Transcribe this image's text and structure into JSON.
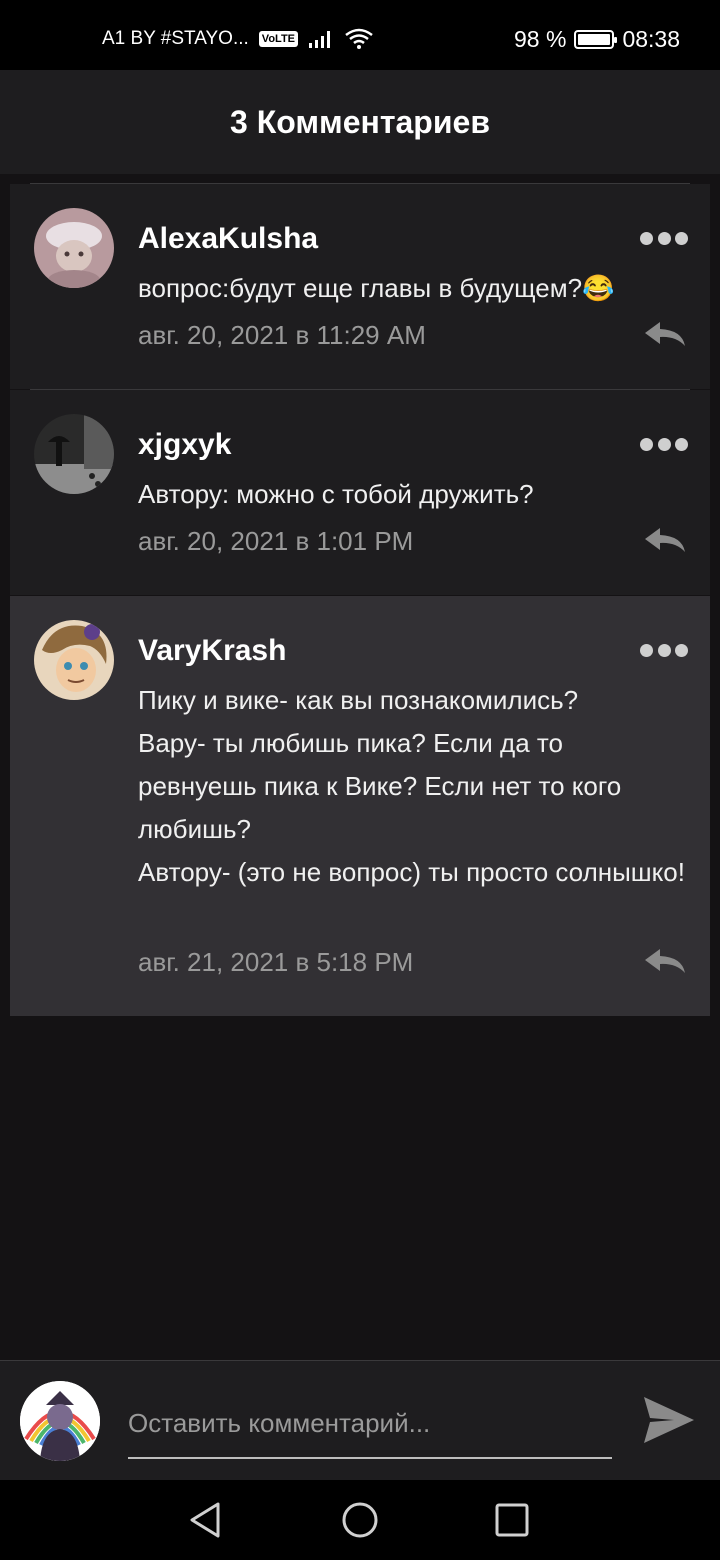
{
  "status_bar": {
    "carrier": "A1 BY #STAYO...",
    "volte": "VoLTE",
    "battery_text": "98 %",
    "battery_level": 0.98,
    "time": "08:38",
    "icons": [
      "signal-icon",
      "wifi-icon",
      "battery-icon"
    ]
  },
  "header": {
    "title": "3 Комментариев"
  },
  "comments": [
    {
      "username": "AlexaKulsha",
      "text": "вопрос:будут еще главы в будущем?😂",
      "date": "авг. 20, 2021 в 11:29 AM"
    },
    {
      "username": "xjgxyk",
      "text": "Автору: можно с тобой дружить?",
      "date": "авг. 20, 2021 в 1:01 PM"
    },
    {
      "username": "VaryKrash",
      "text": "Пику и вике- как вы познакомились?\nВару- ты любишь пика? Если да то ревнуешь пика к Вике? Если нет то кого любишь?\nАвтору- (это не вопрос) ты просто солнышко!",
      "date": "авг. 21, 2021 в 5:18 PM"
    }
  ],
  "comment_input": {
    "placeholder": "Оставить комментарий..."
  },
  "colors": {
    "background": "#141214",
    "header": "#1e1d1f",
    "highlighted_comment": "#323034",
    "muted_text": "#9a9a9a"
  }
}
